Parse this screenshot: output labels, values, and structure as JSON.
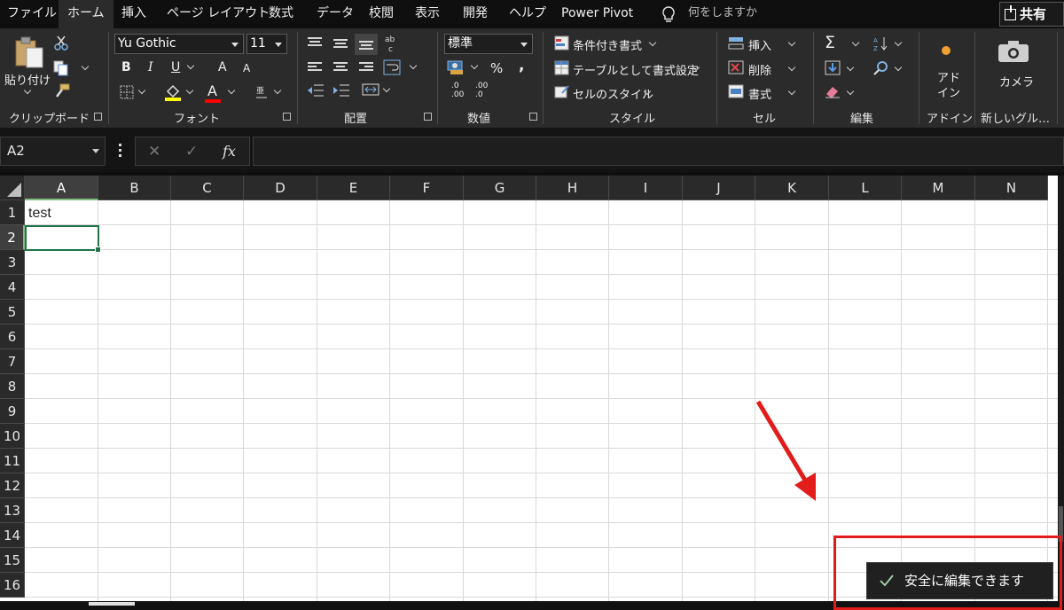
{
  "tabs": {
    "items": [
      {
        "label": "ファイル",
        "active": false
      },
      {
        "label": "ホーム",
        "active": true
      },
      {
        "label": "挿入",
        "active": false
      },
      {
        "label": "ページ レイアウト",
        "active": false
      },
      {
        "label": "数式",
        "active": false
      },
      {
        "label": "データ",
        "active": false
      },
      {
        "label": "校閲",
        "active": false
      },
      {
        "label": "表示",
        "active": false
      },
      {
        "label": "開発",
        "active": false
      },
      {
        "label": "ヘルプ",
        "active": false
      },
      {
        "label": "Power Pivot",
        "active": false
      }
    ],
    "tellme_placeholder": "何をしますか",
    "share_label": "共有"
  },
  "ribbon": {
    "clipboard": {
      "paste_label": "貼り付け",
      "group_label": "クリップボード"
    },
    "font": {
      "name": "Yu Gothic",
      "size": "11",
      "bold": "B",
      "italic": "I",
      "underline": "U",
      "grow": "A",
      "shrink": "A",
      "font_color_glyph": "A",
      "group_label": "フォント"
    },
    "alignment": {
      "group_label": "配置"
    },
    "number": {
      "format": "標準",
      "percent": "%",
      "comma": ",",
      "inc_decimal_top": ".0",
      "inc_decimal_bottom": ".00",
      "dec_decimal_top": ".00",
      "dec_decimal_bottom": ".0",
      "group_label": "数値"
    },
    "styles": {
      "conditional": "条件付き書式",
      "as_table": "テーブルとして書式設定",
      "cell_styles": "セルのスタイル",
      "group_label": "スタイル"
    },
    "cells": {
      "insert": "挿入",
      "delete": "削除",
      "format": "書式",
      "group_label": "セル"
    },
    "editing": {
      "sum": "Σ",
      "group_label": "編集"
    },
    "addins": {
      "button_line1": "アド",
      "button_line2": "イン",
      "group_label": "アドイン"
    },
    "camera": {
      "button_label": "カメラ",
      "group_label": "新しいグル…"
    }
  },
  "formula_bar": {
    "name_box": "A2",
    "cancel": "✕",
    "enter": "✓",
    "fx": "fx",
    "formula": ""
  },
  "sheet": {
    "columns": [
      "A",
      "B",
      "C",
      "D",
      "E",
      "F",
      "G",
      "H",
      "I",
      "J",
      "K",
      "L",
      "M",
      "N"
    ],
    "rows": [
      "1",
      "2",
      "3",
      "4",
      "5",
      "6",
      "7",
      "8",
      "9",
      "10",
      "11",
      "12",
      "13",
      "14",
      "15",
      "16"
    ],
    "selected_column": "A",
    "selected_row": "2",
    "cells": {
      "A1": "test"
    }
  },
  "toast": {
    "message": "安全に編集できます",
    "icon": "check-icon"
  },
  "colors": {
    "accent_green": "#217346",
    "annotation_red": "#e21b1b",
    "ribbon_bg": "#2b2b2b"
  }
}
